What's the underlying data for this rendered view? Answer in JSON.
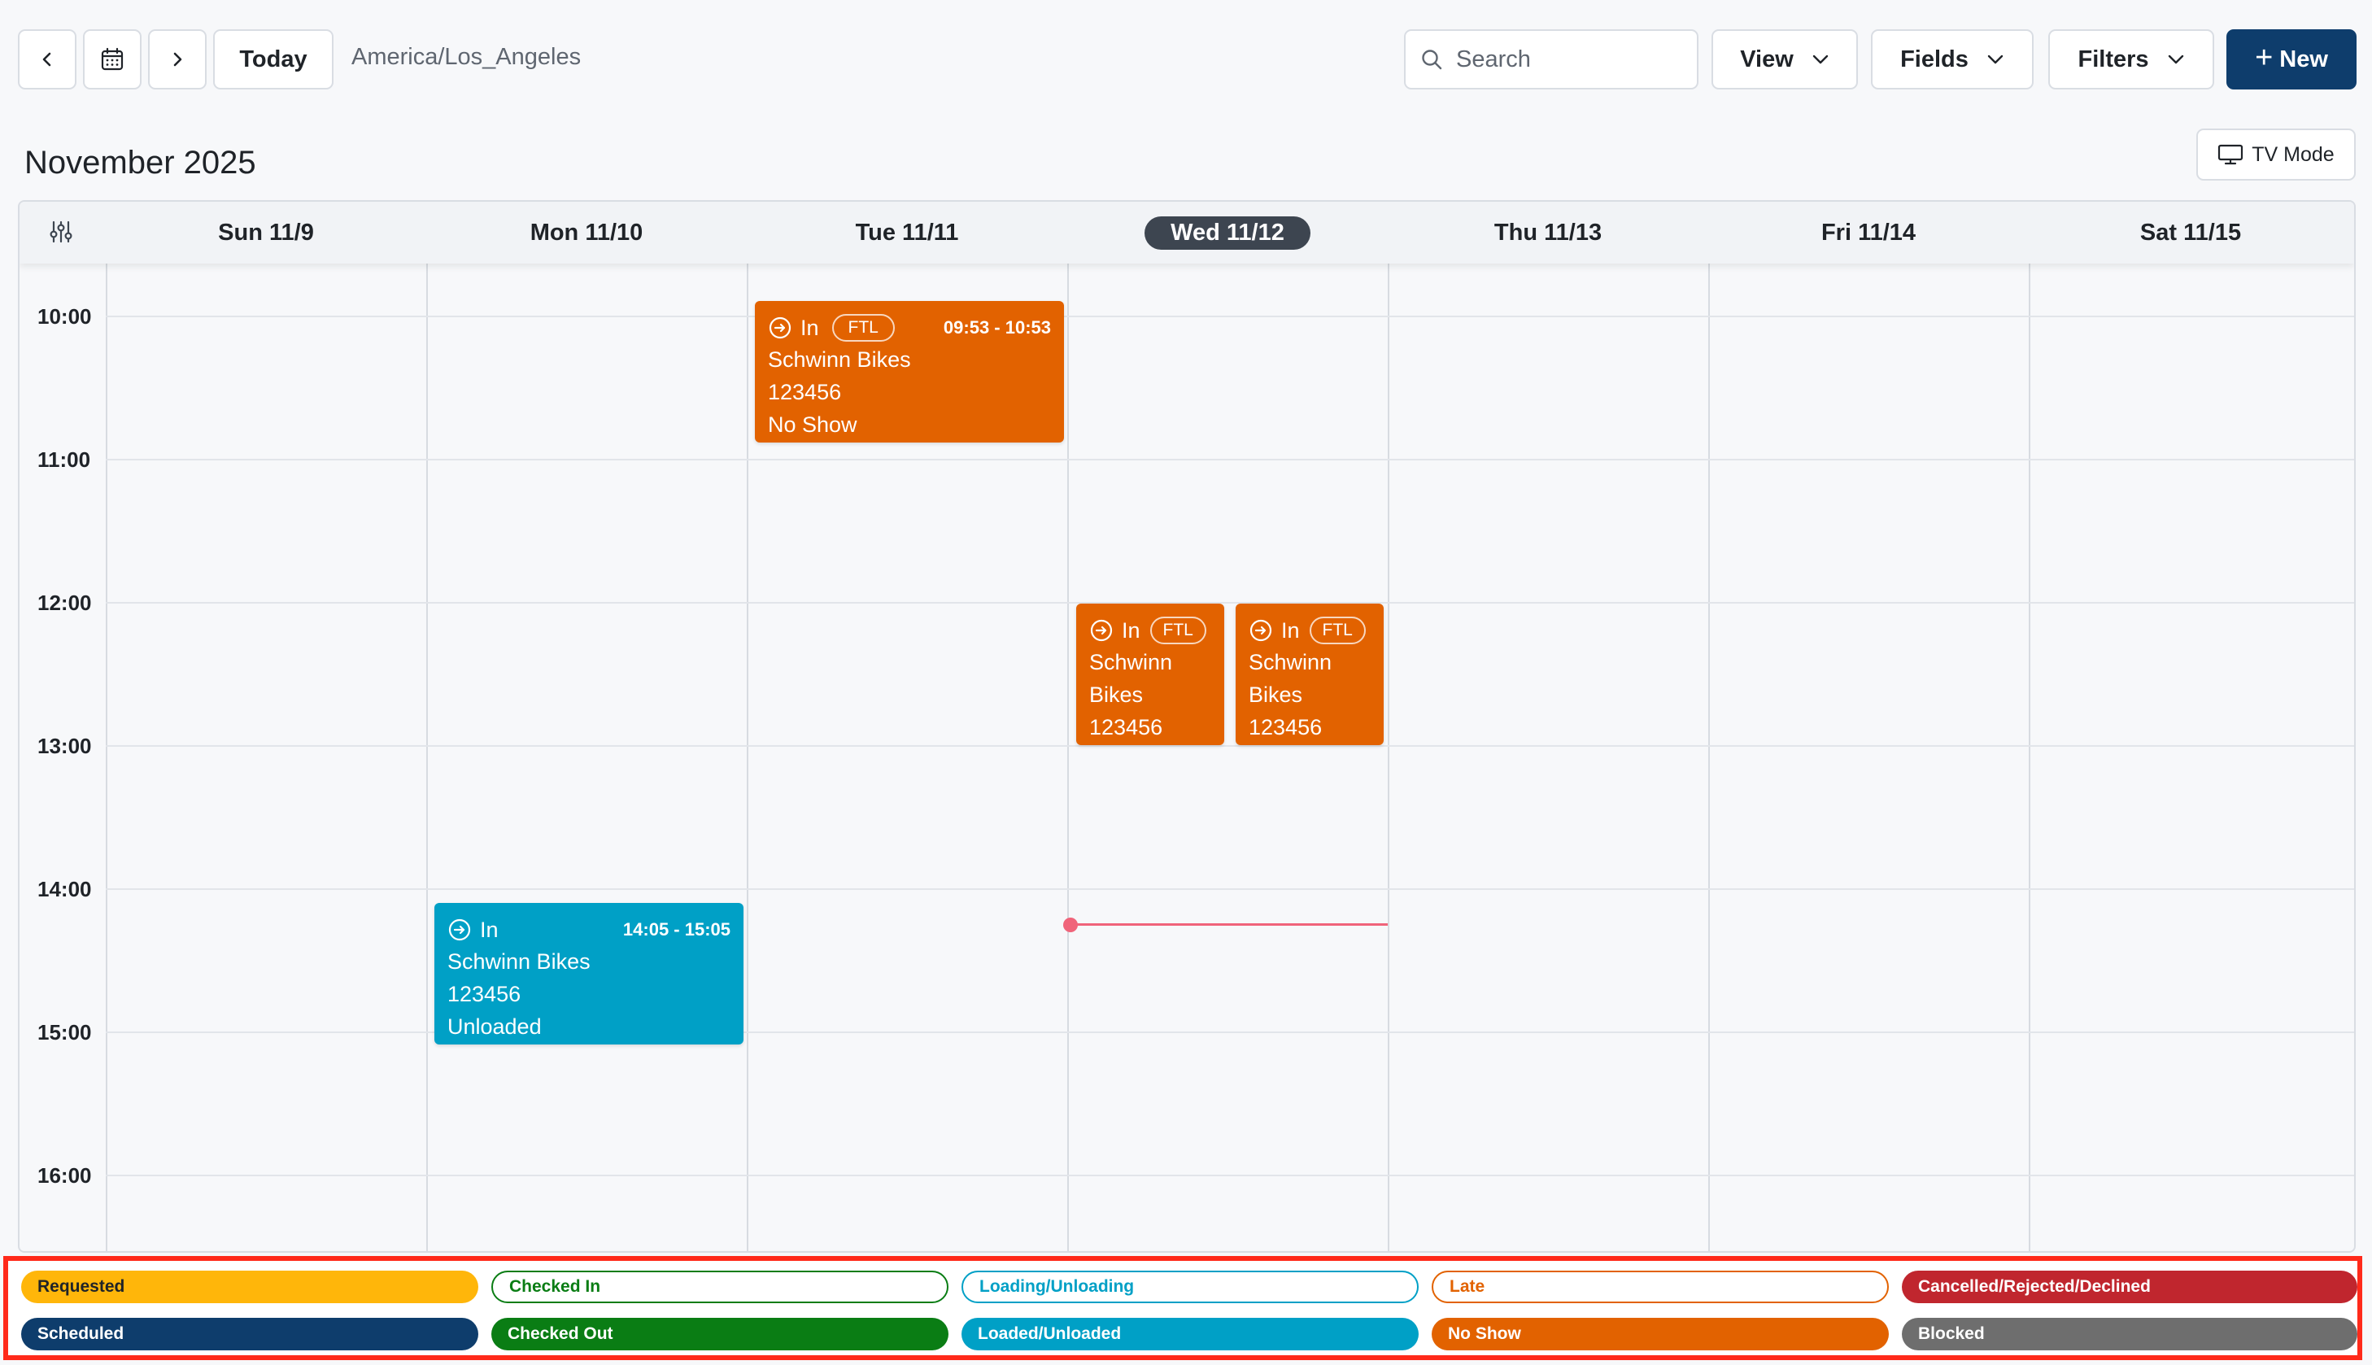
{
  "toolbar": {
    "today_label": "Today",
    "timezone": "America/Los_Angeles",
    "search_placeholder": "Search",
    "view_label": "View",
    "fields_label": "Fields",
    "filters_label": "Filters",
    "new_label": "New"
  },
  "header": {
    "month_title": "November 2025",
    "tv_mode_label": "TV Mode"
  },
  "days": [
    "Sun 11/9",
    "Mon 11/10",
    "Tue 11/11",
    "Wed 11/12",
    "Thu 11/13",
    "Fri 11/14",
    "Sat 11/15"
  ],
  "times": [
    "10:00",
    "11:00",
    "12:00",
    "13:00",
    "14:00",
    "15:00",
    "16:00"
  ],
  "events": {
    "tue": {
      "direction": "In",
      "tag": "FTL",
      "time": "09:53 - 10:53",
      "company": "Schwinn Bikes",
      "number": "123456",
      "status": "No Show"
    },
    "wed1": {
      "direction": "In",
      "tag": "FTL",
      "company_a": "Schwinn",
      "company_b": "Bikes",
      "number": "123456"
    },
    "wed2": {
      "direction": "In",
      "tag": "FTL",
      "company_a": "Schwinn",
      "company_b": "Bikes",
      "number": "123456"
    },
    "mon": {
      "direction": "In",
      "time": "14:05 - 15:05",
      "company": "Schwinn Bikes",
      "number": "123456",
      "status": "Unloaded"
    }
  },
  "legend": {
    "requested": "Requested",
    "checked_in": "Checked In",
    "loading_unloading": "Loading/Unloading",
    "late": "Late",
    "cancelled": "Cancelled/Rejected/Declined",
    "scheduled": "Scheduled",
    "checked_out": "Checked Out",
    "loaded_unloaded": "Loaded/Unloaded",
    "no_show": "No Show",
    "blocked": "Blocked"
  },
  "colors": {
    "primary": "#0e3d6c",
    "no_show": "#e26200",
    "unloaded": "#00a0c6",
    "requested": "#ffb60a",
    "checked_out": "#0a7d14",
    "cancelled": "#c0262e",
    "blocked": "#6e6e6e",
    "now_line": "#f0647a"
  }
}
